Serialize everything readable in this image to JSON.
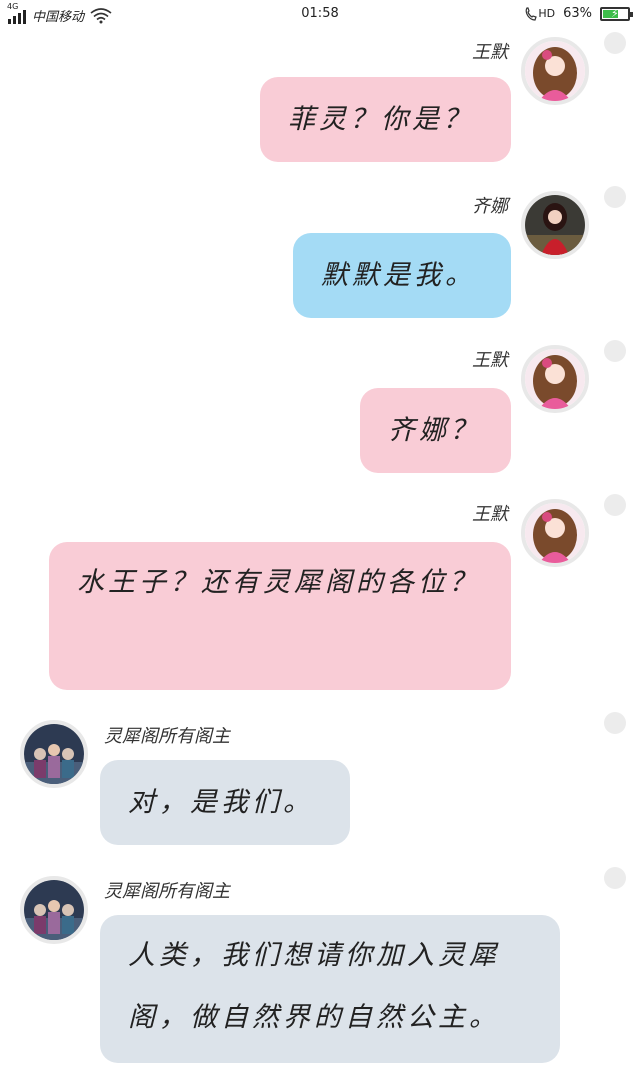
{
  "status_bar": {
    "network": "4G",
    "carrier": "中国移动",
    "time": "01:58",
    "hd_label": "HD",
    "battery": "63%",
    "battery_level": 0.63,
    "battery_color": "#3dbd4a"
  },
  "colors": {
    "pink_bubble": "#f9ccd6",
    "blue_bubble": "#a4dbf5",
    "gray_bubble": "#dce3ea"
  },
  "messages": [
    {
      "sender": "王默",
      "text": "菲灵？你是？",
      "side": "right",
      "bubble": "pink",
      "avatar": "wangmo-avatar"
    },
    {
      "sender": "齐娜",
      "text": "默默是我。",
      "side": "right",
      "bubble": "blue",
      "avatar": "qina-avatar"
    },
    {
      "sender": "王默",
      "text": "齐娜？",
      "side": "right",
      "bubble": "pink",
      "avatar": "wangmo-avatar"
    },
    {
      "sender": "王默",
      "text": "水王子？还有灵犀阁的各位？",
      "side": "right",
      "bubble": "pink",
      "avatar": "wangmo-avatar"
    },
    {
      "sender": "灵犀阁所有阁主",
      "text": "对，是我们。",
      "side": "left",
      "bubble": "gray",
      "avatar": "group-avatar"
    },
    {
      "sender": "灵犀阁所有阁主",
      "text": "人类，我们想请你加入灵犀阁，做自然界的自然公主。",
      "side": "left",
      "bubble": "gray",
      "avatar": "group-avatar"
    }
  ]
}
